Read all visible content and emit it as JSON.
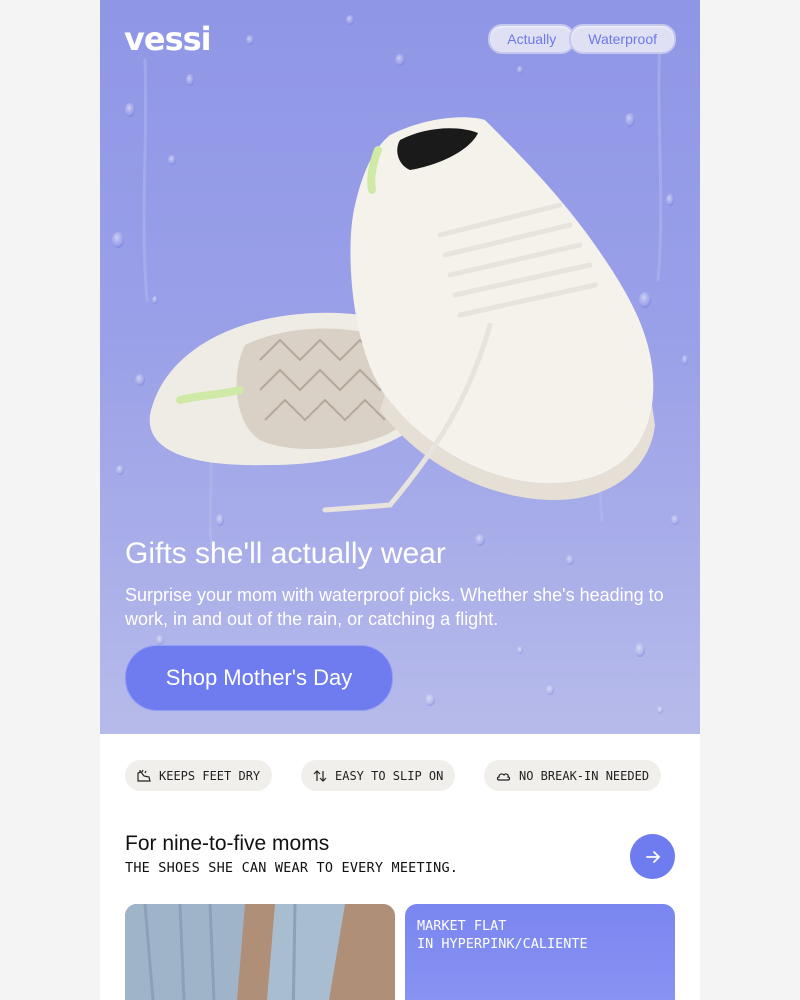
{
  "brand": {
    "logo_text": "vessi"
  },
  "header_pills": [
    "Actually",
    "Waterproof"
  ],
  "hero": {
    "title": "Gifts she'll actually wear",
    "body": "Surprise your mom with waterproof picks. Whether she's heading to work, in and out of the rain, or catching a flight.",
    "cta_label": "Shop Mother's Day",
    "image_icon": "white-knit-sneakers-image"
  },
  "features": [
    {
      "icon": "shoe-dry-icon",
      "label": "KEEPS FEET DRY"
    },
    {
      "icon": "up-down-arrows-icon",
      "label": "EASY TO SLIP ON"
    },
    {
      "icon": "cloud-icon",
      "label": "NO BREAK-IN NEEDED"
    }
  ],
  "section": {
    "title": "For nine-to-five moms",
    "subtitle": "THE SHOES SHE CAN WEAR TO EVERY MEETING.",
    "arrow_icon": "arrow-right-icon"
  },
  "cards": [
    {
      "image_icon": "jeans-photo-image",
      "label_line1": "",
      "label_line2": ""
    },
    {
      "label_line1": "MARKET FLAT",
      "label_line2": "IN HYPERPINK/CALIENTE"
    }
  ],
  "colors": {
    "hero_bg": "#959ce7",
    "accent": "#6e7cf0",
    "chip_bg": "#f1efeb",
    "pill_text": "#6f78e6"
  }
}
